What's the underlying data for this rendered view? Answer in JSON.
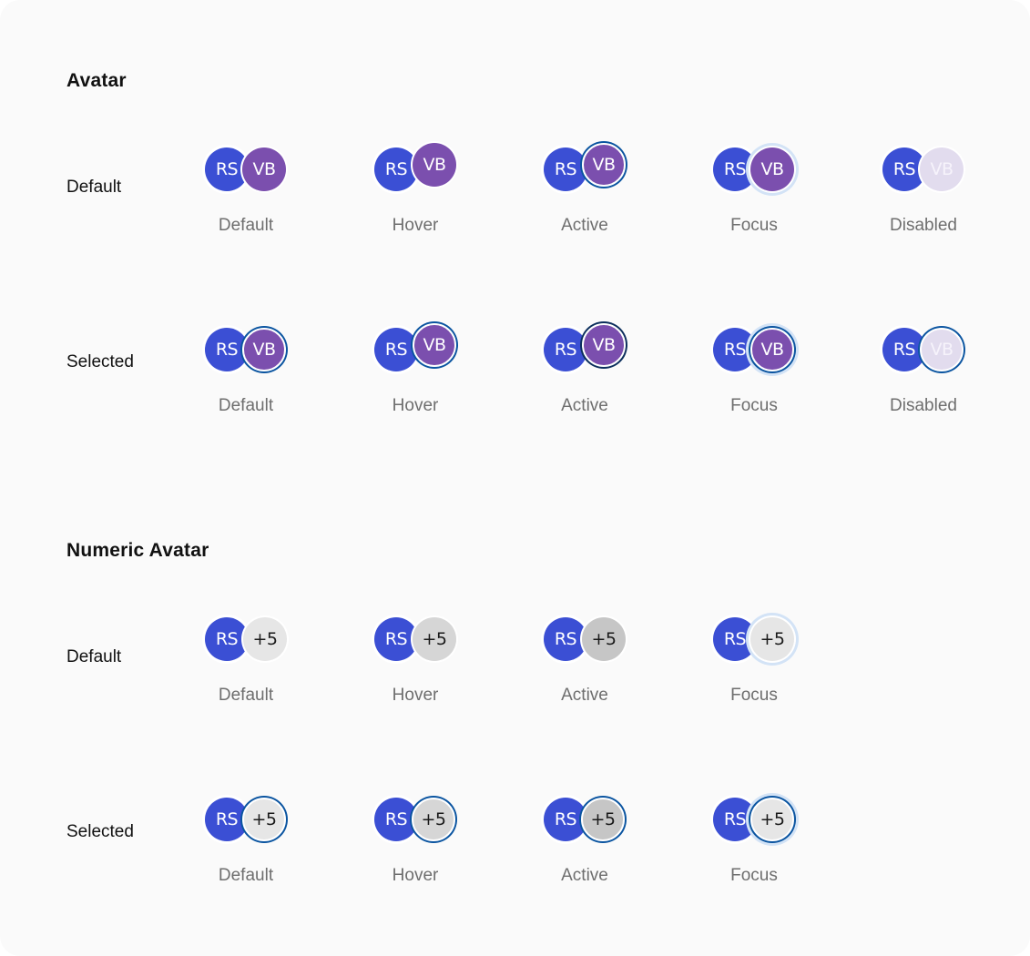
{
  "colors": {
    "primary_avatar": "#3b4fd4",
    "secondary_avatar": "#7b4fae",
    "secondary_avatar_disabled": "#e2dcee",
    "numeric_default": "#e6e6e6",
    "numeric_hover": "#d6d6d6",
    "numeric_active": "#c6c6c6",
    "ring_selected": "#0a54a0",
    "ring_active": "#0b2e5c",
    "ring_focus": "#d3e3f6",
    "background": "#fafafa"
  },
  "sections": [
    {
      "title": "Avatar",
      "rows": [
        {
          "label": "Default",
          "cells": [
            {
              "state": "Default",
              "first": "RS",
              "second": "VB"
            },
            {
              "state": "Hover",
              "first": "RS",
              "second": "VB"
            },
            {
              "state": "Active",
              "first": "RS",
              "second": "VB"
            },
            {
              "state": "Focus",
              "first": "RS",
              "second": "VB"
            },
            {
              "state": "Disabled",
              "first": "RS",
              "second": "VB"
            }
          ]
        },
        {
          "label": "Selected",
          "cells": [
            {
              "state": "Default",
              "first": "RS",
              "second": "VB"
            },
            {
              "state": "Hover",
              "first": "RS",
              "second": "VB"
            },
            {
              "state": "Active",
              "first": "RS",
              "second": "VB"
            },
            {
              "state": "Focus",
              "first": "RS",
              "second": "VB"
            },
            {
              "state": "Disabled",
              "first": "RS",
              "second": "VB"
            }
          ]
        }
      ]
    },
    {
      "title": "Numeric Avatar",
      "rows": [
        {
          "label": "Default",
          "cells": [
            {
              "state": "Default",
              "first": "RS",
              "second": "+5"
            },
            {
              "state": "Hover",
              "first": "RS",
              "second": "+5"
            },
            {
              "state": "Active",
              "first": "RS",
              "second": "+5"
            },
            {
              "state": "Focus",
              "first": "RS",
              "second": "+5"
            }
          ]
        },
        {
          "label": "Selected",
          "cells": [
            {
              "state": "Default",
              "first": "RS",
              "second": "+5"
            },
            {
              "state": "Hover",
              "first": "RS",
              "second": "+5"
            },
            {
              "state": "Active",
              "first": "RS",
              "second": "+5"
            },
            {
              "state": "Focus",
              "first": "RS",
              "second": "+5"
            }
          ]
        }
      ]
    }
  ]
}
